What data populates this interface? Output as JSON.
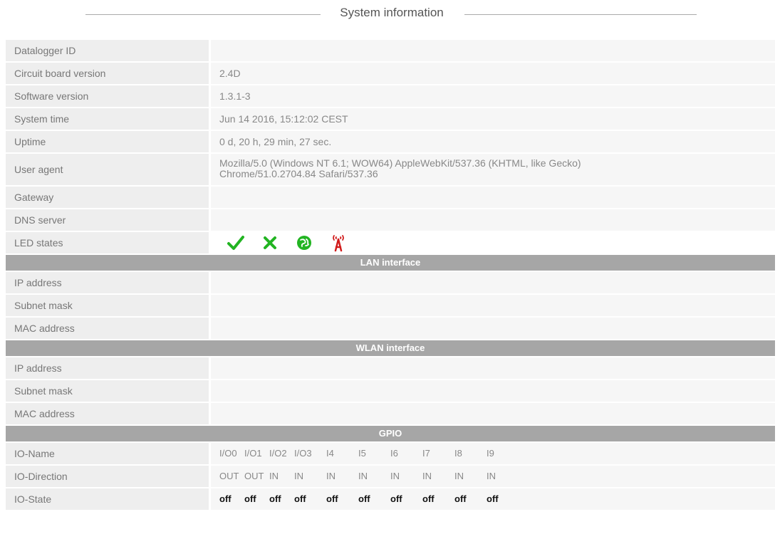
{
  "header": {
    "title": "System information"
  },
  "system": {
    "rows": [
      {
        "label": "Datalogger ID",
        "value": ""
      },
      {
        "label": "Circuit board version",
        "value": "2.4D"
      },
      {
        "label": "Software version",
        "value": "1.3.1-3"
      },
      {
        "label": "System time",
        "value": "Jun 14 2016, 15:12:02 CEST"
      },
      {
        "label": "Uptime",
        "value": "0 d, 20 h, 29 min, 27 sec."
      }
    ],
    "user_agent": {
      "label": "User agent",
      "line1": "Mozilla/5.0 (Windows NT 6.1; WOW64) AppleWebKit/537.36 (KHTML, like Gecko)",
      "line2": "Chrome/51.0.2704.84 Safari/537.36"
    },
    "gateway": {
      "label": "Gateway",
      "value": ""
    },
    "dns": {
      "label": "DNS server",
      "value": ""
    },
    "led": {
      "label": "LED states",
      "icons": [
        "check-icon",
        "cross-icon",
        "globe-icon",
        "antenna-icon"
      ],
      "colors": {
        "check": "#22b422",
        "cross": "#22b422",
        "globe": "#22b422",
        "antenna": "#d11a1a"
      }
    }
  },
  "lan": {
    "title": "LAN interface",
    "rows": [
      {
        "label": "IP address",
        "value": ""
      },
      {
        "label": "Subnet mask",
        "value": ""
      },
      {
        "label": "MAC address",
        "value": ""
      }
    ]
  },
  "wlan": {
    "title": "WLAN interface",
    "rows": [
      {
        "label": "IP address",
        "value": ""
      },
      {
        "label": "Subnet mask",
        "value": ""
      },
      {
        "label": "MAC address",
        "value": ""
      }
    ]
  },
  "gpio": {
    "title": "GPIO",
    "name_label": "IO-Name",
    "direction_label": "IO-Direction",
    "state_label": "IO-State",
    "names": [
      "I/O0",
      "I/O1",
      "I/O2",
      "I/O3",
      "I4",
      "I5",
      "I6",
      "I7",
      "I8",
      "I9"
    ],
    "directions": [
      "OUT",
      "OUT",
      "IN",
      "IN",
      "IN",
      "IN",
      "IN",
      "IN",
      "IN",
      "IN"
    ],
    "states": [
      "off",
      "off",
      "off",
      "off",
      "off",
      "off",
      "off",
      "off",
      "off",
      "off"
    ]
  }
}
